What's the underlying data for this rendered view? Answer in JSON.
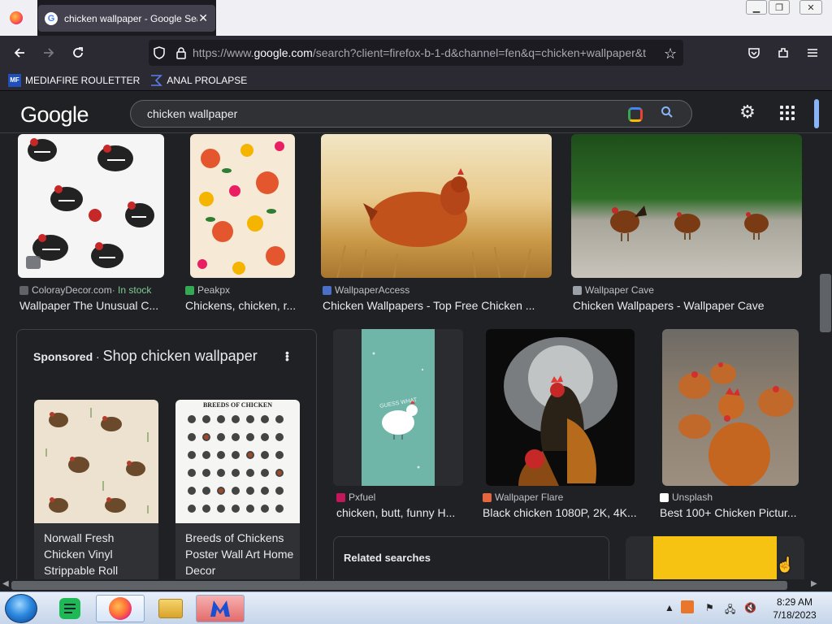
{
  "browser": {
    "tab_title": "chicken wallpaper - Google Search",
    "tab_close": "✕",
    "url_prefix": "https://www.",
    "url_domain": "google.com",
    "url_rest": "/search?client=firefox-b-1-d&channel=fen&q=chicken+wallpaper&t",
    "window_controls": {
      "minimize": "▁",
      "restore": "❐",
      "close": "✕"
    },
    "bookmarks": [
      {
        "label": "MEDIAFIRE ROULETTER",
        "icon": "mediafire-icon"
      },
      {
        "label": "ANAL PROLAPSE",
        "icon": "bookmark-icon"
      }
    ]
  },
  "google": {
    "logo": "Google",
    "query": "chicken wallpaper"
  },
  "results_row1": [
    {
      "source": "ColorayDecor.com",
      "stock": " · In stock",
      "title": "Wallpaper The Unusual C...",
      "fav": "#5f6368"
    },
    {
      "source": "Peakpx",
      "stock": "",
      "title": "Chickens, chicken, r...",
      "fav": "#34a853"
    },
    {
      "source": "WallpaperAccess",
      "stock": "",
      "title": "Chicken Wallpapers - Top Free Chicken ...",
      "fav": "#4a6fc7"
    },
    {
      "source": "Wallpaper Cave",
      "stock": "",
      "title": "Chicken Wallpapers - Wallpaper Cave",
      "fav": "#9aa0a6"
    }
  ],
  "results_row2": [
    {
      "source": "Pxfuel",
      "title": "chicken, butt, funny H...",
      "fav": "#c2185b"
    },
    {
      "source": "Wallpaper Flare",
      "title": "Black chicken 1080P, 2K, 4K...",
      "fav": "#e8663d"
    },
    {
      "source": "Unsplash",
      "title": "Best 100+ Chicken Pictur...",
      "fav": "#ffffff"
    }
  ],
  "sponsored": {
    "label": "Sponsored",
    "sep": " · ",
    "heading": "Shop chicken wallpaper",
    "products": [
      {
        "title": "Norwall Fresh Chicken Vinyl Strippable Roll"
      },
      {
        "title": "Breeds of Chickens Poster Wall Art Home Decor",
        "poster_text": "BREEDS OF CHICKEN"
      }
    ]
  },
  "related": {
    "heading": "Related searches"
  },
  "thumb_text": {
    "pxfuel_overlay": "GUESS WHAT"
  },
  "taskbar": {
    "time": "8:29 AM",
    "date": "7/18/2023"
  }
}
